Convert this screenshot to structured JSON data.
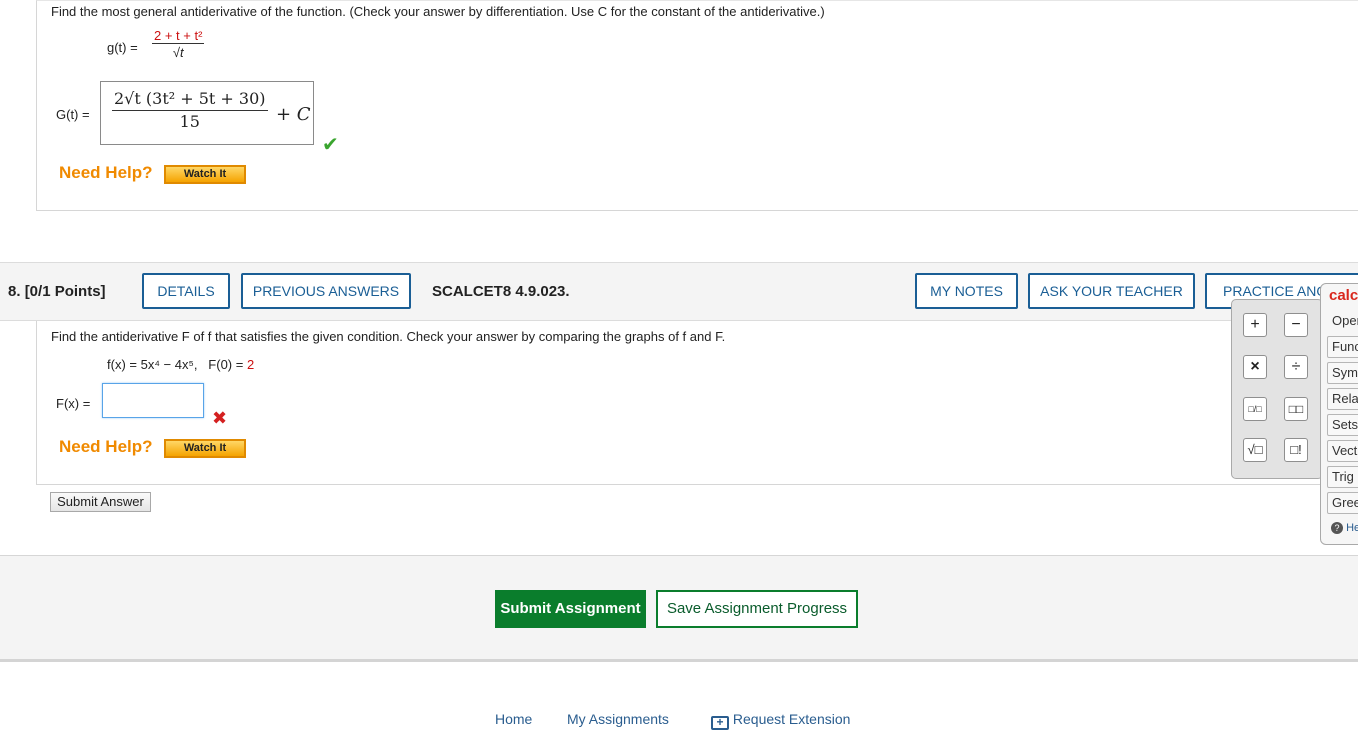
{
  "q7": {
    "prompt": "Find the most general antiderivative of the function. (Check your answer by differentiation. Use C for the constant of the antiderivative.)",
    "g_label": "g(t) =",
    "g_numerator": "2 + t + t²",
    "g_denominator": "√t",
    "G_label": "G(t) =",
    "G_numerator": "2√t (3t² + 5t + 30)",
    "G_denominator": "15",
    "G_constant": "+ C",
    "need_help": "Need Help?",
    "watch_it": "Watch It"
  },
  "q8": {
    "number": "8.",
    "points": "[0/1 Points]",
    "buttons": {
      "details": "DETAILS",
      "previous_answers": "PREVIOUS ANSWERS",
      "my_notes": "MY NOTES",
      "ask_teacher": "ASK YOUR TEACHER",
      "practice": "PRACTICE ANO"
    },
    "code": "SCALCET8 4.9.023.",
    "prompt": "Find the antiderivative F of f that satisfies the given condition. Check your answer by comparing the graphs of f and F.",
    "f_def": "f(x) = 5x⁴ − 4x⁵,",
    "cond_left": "F(0) =",
    "cond_right": "2",
    "F_label": "F(x) =",
    "input_value": "",
    "need_help": "Need Help?",
    "watch_it": "Watch It",
    "submit_answer": "Submit Answer"
  },
  "calculator": {
    "title": "calc",
    "keys": [
      "+",
      "−",
      "×",
      "÷",
      "□/□",
      "□□",
      "√□",
      "□!"
    ],
    "categories": [
      "Oper",
      "Func",
      "Sym",
      "Rela",
      "Sets",
      "Vect",
      "Trig",
      "Gree"
    ],
    "help": "He"
  },
  "footer": {
    "submit_assignment": "Submit Assignment",
    "save_progress": "Save Assignment Progress",
    "links": [
      "Home",
      "My Assignments",
      "Request Extension"
    ]
  },
  "colors": {
    "brand_blue": "#1a5e95",
    "help_orange": "#f08a00",
    "submit_green": "#0a7d2c",
    "correct_green": "#3aa52f",
    "wrong_red": "#d42020"
  }
}
